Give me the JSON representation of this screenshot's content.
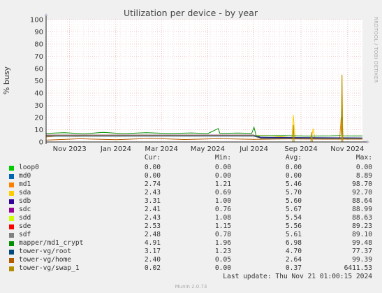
{
  "chart_data": {
    "type": "line",
    "title": "Utilization per device - by year",
    "ylabel": "% busy",
    "ylim": [
      0,
      100
    ],
    "yticks": [
      0,
      10,
      20,
      30,
      40,
      50,
      60,
      70,
      80,
      90,
      100
    ],
    "xticks": [
      "Nov 2023",
      "Jan 2024",
      "Mar 2024",
      "May 2024",
      "Jul 2024",
      "Sep 2024",
      "Nov 2024"
    ],
    "xrange": [
      "2023-10-01",
      "2024-11-21"
    ],
    "side_text": "RRDTOOL / TOBI OETIKER",
    "grid": true,
    "series": [
      {
        "name": "loop0",
        "color": "#00cc00",
        "cur": "0.00",
        "min": "0.00",
        "avg": "0.00",
        "max": "0.00",
        "points": [
          [
            "2023-10-01",
            0
          ],
          [
            "2024-11-21",
            0
          ]
        ]
      },
      {
        "name": "md0",
        "color": "#0066b3",
        "cur": "0.00",
        "min": "0.00",
        "avg": "0.00",
        "max": "8.89",
        "points": [
          [
            "2023-10-01",
            0
          ],
          [
            "2024-11-21",
            0
          ]
        ]
      },
      {
        "name": "md1",
        "color": "#ff8000",
        "cur": "2.74",
        "min": "1.21",
        "avg": "5.46",
        "max": "98.70",
        "points": [
          [
            "2023-10-01",
            4
          ],
          [
            "2023-10-20",
            5.2
          ],
          [
            "2023-11-10",
            4.6
          ],
          [
            "2023-12-05",
            5.4
          ],
          [
            "2024-01-05",
            4.8
          ],
          [
            "2024-02-05",
            5.6
          ],
          [
            "2024-03-05",
            5.1
          ],
          [
            "2024-04-05",
            5.5
          ],
          [
            "2024-05-05",
            5.0
          ],
          [
            "2024-06-05",
            5.3
          ],
          [
            "2024-06-30",
            4.9
          ],
          [
            "2024-07-10",
            3.0
          ],
          [
            "2024-08-10",
            2.6
          ],
          [
            "2024-09-10",
            2.9
          ],
          [
            "2024-10-10",
            2.7
          ],
          [
            "2024-10-22",
            3.1
          ],
          [
            "2024-10-24",
            20.5
          ],
          [
            "2024-10-26",
            3.0
          ],
          [
            "2024-11-21",
            2.7
          ]
        ]
      },
      {
        "name": "sda",
        "color": "#ffcc00",
        "cur": "2.43",
        "min": "0.69",
        "avg": "5.70",
        "max": "92.70",
        "points": [
          [
            "2023-10-01",
            5
          ],
          [
            "2024-07-20",
            5.2
          ],
          [
            "2024-08-20",
            3.5
          ],
          [
            "2024-08-22",
            22
          ],
          [
            "2024-08-24",
            3.5
          ],
          [
            "2024-09-15",
            3.6
          ],
          [
            "2024-09-17",
            11
          ],
          [
            "2024-09-19",
            3.5
          ],
          [
            "2024-10-24",
            3.3
          ],
          [
            "2024-10-25",
            54
          ],
          [
            "2024-10-26",
            3.0
          ],
          [
            "2024-11-21",
            2.4
          ]
        ]
      },
      {
        "name": "sdb",
        "color": "#330099",
        "cur": "3.31",
        "min": "1.00",
        "avg": "5.60",
        "max": "88.64",
        "points": [
          [
            "2023-10-01",
            5.6
          ],
          [
            "2024-07-01",
            5.6
          ],
          [
            "2024-07-10",
            3.8
          ],
          [
            "2024-11-21",
            3.3
          ]
        ]
      },
      {
        "name": "sdc",
        "color": "#990099",
        "cur": "2.41",
        "min": "0.76",
        "avg": "5.67",
        "max": "88.99",
        "points": [
          [
            "2023-10-01",
            5.4
          ],
          [
            "2024-07-01",
            5.5
          ],
          [
            "2024-07-10",
            3.2
          ],
          [
            "2024-11-21",
            2.4
          ]
        ]
      },
      {
        "name": "sdd",
        "color": "#ccff00",
        "cur": "2.43",
        "min": "1.08",
        "avg": "5.54",
        "max": "88.63",
        "points": [
          [
            "2023-10-01",
            5.3
          ],
          [
            "2024-07-01",
            5.4
          ],
          [
            "2024-07-10",
            3.0
          ],
          [
            "2024-11-21",
            2.4
          ]
        ]
      },
      {
        "name": "sde",
        "color": "#ff0000",
        "cur": "2.53",
        "min": "1.15",
        "avg": "5.56",
        "max": "89.23",
        "points": [
          [
            "2023-10-01",
            5.5
          ],
          [
            "2024-07-01",
            5.5
          ],
          [
            "2024-07-10",
            3.1
          ],
          [
            "2024-11-21",
            2.5
          ]
        ]
      },
      {
        "name": "sdf",
        "color": "#808080",
        "cur": "2.48",
        "min": "0.78",
        "avg": "5.61",
        "max": "89.10",
        "points": [
          [
            "2023-10-01",
            5.6
          ],
          [
            "2024-07-01",
            5.6
          ],
          [
            "2024-07-10",
            3.0
          ],
          [
            "2024-11-21",
            2.5
          ]
        ]
      },
      {
        "name": "mapper/md1_crypt",
        "color": "#008f00",
        "cur": "4.91",
        "min": "1.96",
        "avg": "6.98",
        "max": "99.48",
        "points": [
          [
            "2023-10-01",
            7.0
          ],
          [
            "2023-10-25",
            7.6
          ],
          [
            "2023-11-20",
            6.6
          ],
          [
            "2023-12-15",
            7.8
          ],
          [
            "2024-01-10",
            6.8
          ],
          [
            "2024-02-10",
            7.6
          ],
          [
            "2024-03-10",
            6.9
          ],
          [
            "2024-04-10",
            7.4
          ],
          [
            "2024-05-01",
            6.8
          ],
          [
            "2024-05-15",
            11
          ],
          [
            "2024-05-17",
            7.0
          ],
          [
            "2024-06-10",
            7.3
          ],
          [
            "2024-06-28",
            7.0
          ],
          [
            "2024-07-01",
            12
          ],
          [
            "2024-07-04",
            5.0
          ],
          [
            "2024-08-10",
            5.2
          ],
          [
            "2024-09-10",
            4.8
          ],
          [
            "2024-10-10",
            5.0
          ],
          [
            "2024-10-24",
            5.3
          ],
          [
            "2024-10-25",
            30
          ],
          [
            "2024-10-26",
            5.0
          ],
          [
            "2024-11-21",
            4.9
          ]
        ]
      },
      {
        "name": "tower-vg/root",
        "color": "#00487d",
        "cur": "3.17",
        "min": "1.23",
        "avg": "4.70",
        "max": "77.37",
        "points": [
          [
            "2023-10-01",
            4.7
          ],
          [
            "2024-07-01",
            4.8
          ],
          [
            "2024-07-10",
            3.4
          ],
          [
            "2024-11-21",
            3.2
          ]
        ]
      },
      {
        "name": "tower-vg/home",
        "color": "#b35a00",
        "cur": "2.40",
        "min": "0.05",
        "avg": "2.64",
        "max": "99.39",
        "points": [
          [
            "2023-10-01",
            1.5
          ],
          [
            "2023-11-15",
            2.6
          ],
          [
            "2024-01-01",
            1.8
          ],
          [
            "2024-02-15",
            2.9
          ],
          [
            "2024-04-01",
            2.0
          ],
          [
            "2024-05-15",
            2.7
          ],
          [
            "2024-07-01",
            2.2
          ],
          [
            "2024-08-15",
            2.5
          ],
          [
            "2024-10-01",
            2.3
          ],
          [
            "2024-11-21",
            2.4
          ]
        ]
      },
      {
        "name": "tower-vg/swap_1",
        "color": "#b38f00",
        "cur": "0.02",
        "min": "0.00",
        "avg": "0.37",
        "max": "6411.53",
        "points": [
          [
            "2023-10-01",
            0
          ],
          [
            "2024-08-21",
            0
          ],
          [
            "2024-08-22",
            14
          ],
          [
            "2024-08-23",
            0
          ],
          [
            "2024-09-14",
            0
          ],
          [
            "2024-09-15",
            8
          ],
          [
            "2024-09-16",
            0
          ],
          [
            "2024-10-24",
            0
          ],
          [
            "2024-10-25",
            55
          ],
          [
            "2024-10-26",
            0
          ],
          [
            "2024-11-21",
            0
          ]
        ]
      }
    ]
  },
  "legend_headers": {
    "cur": "Cur:",
    "min": "Min:",
    "avg": "Avg:",
    "max": "Max:"
  },
  "last_update": "Last update: Thu Nov 21 01:00:15 2024",
  "footer": "Munin 2.0.73"
}
